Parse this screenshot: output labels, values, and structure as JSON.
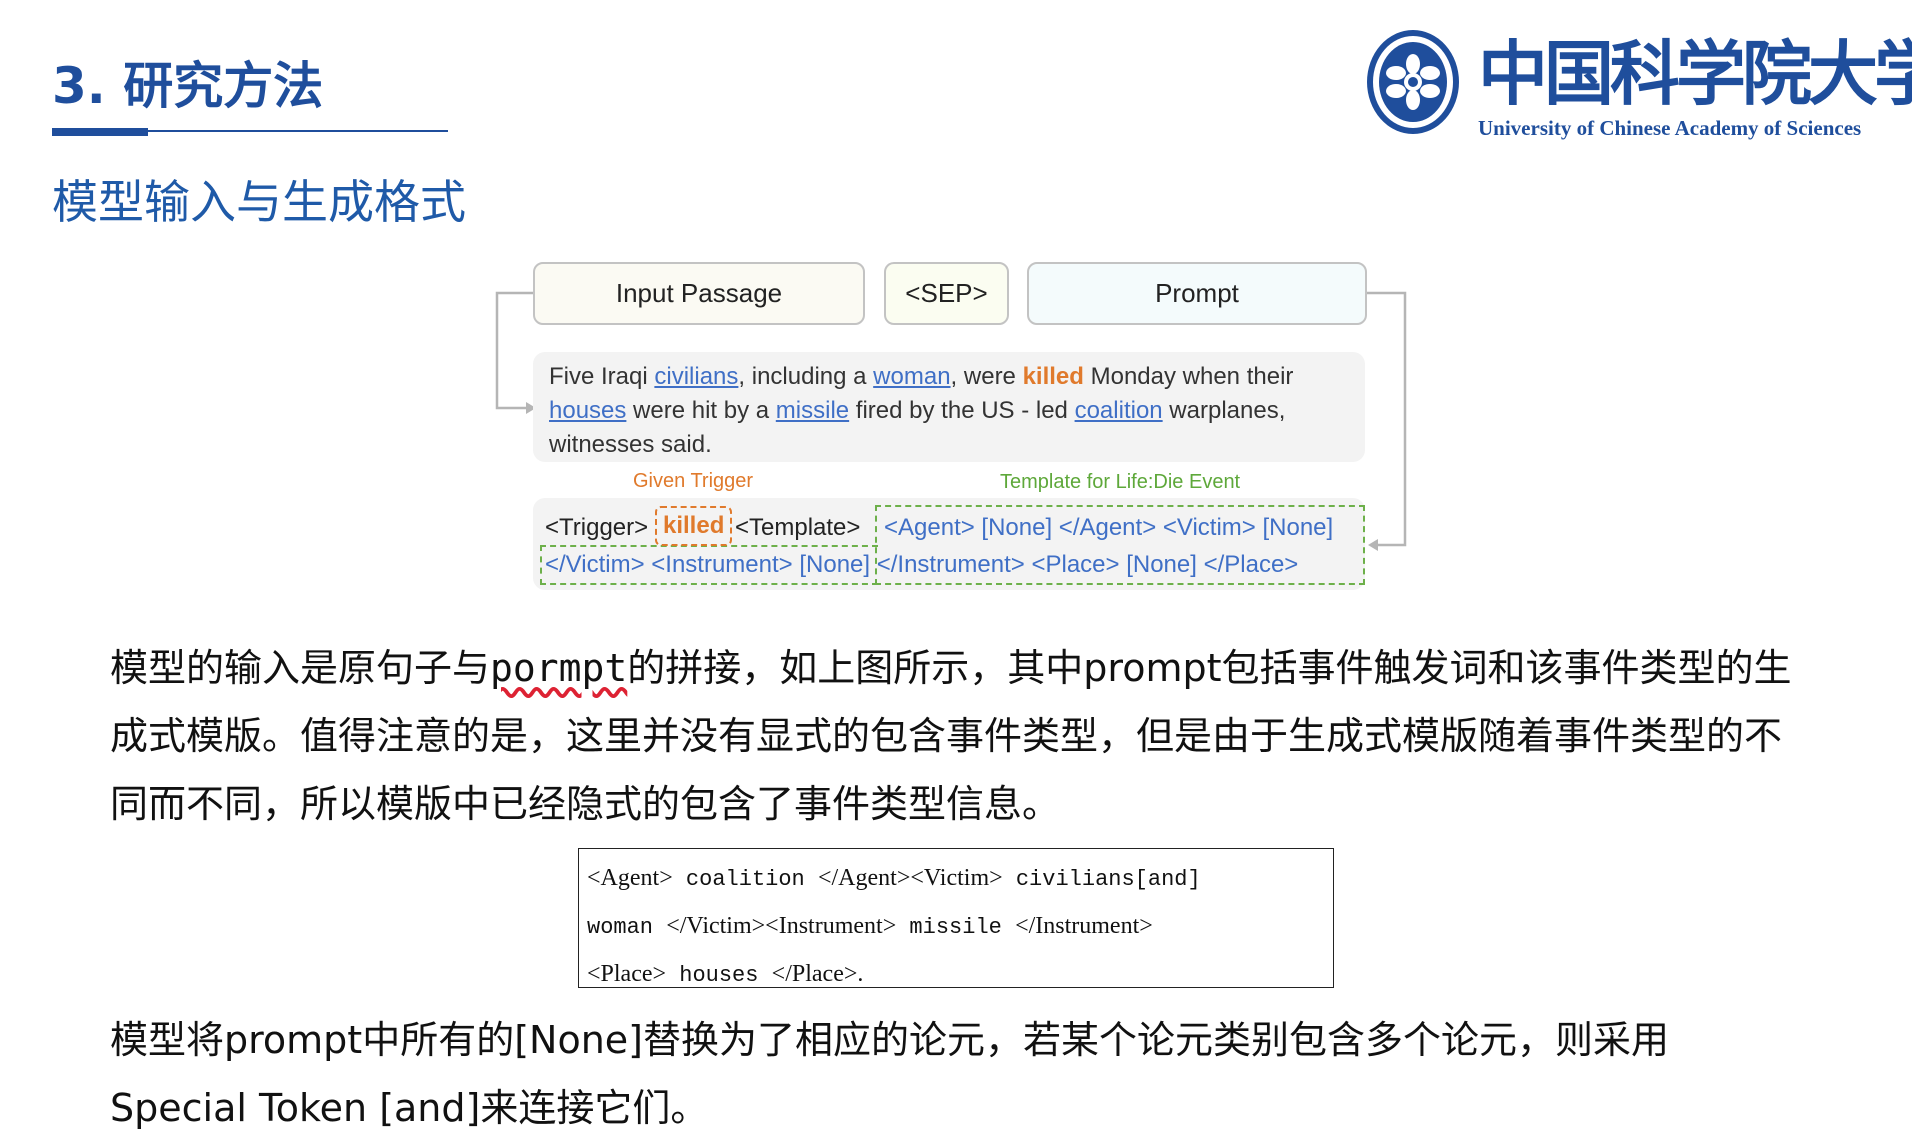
{
  "header": {
    "title": "3. 研究方法",
    "subtitle": "模型输入与生成格式"
  },
  "logo": {
    "chinese_name": "中国科学院大学",
    "english_name": "University of  Chinese Academy of Sciences"
  },
  "diagram": {
    "input_passage_label": "Input Passage",
    "sep_label": "<SEP>",
    "prompt_label": "Prompt",
    "passage": {
      "t1": "Five Iraqi ",
      "a1": "civilians",
      "t2": ", including a ",
      "a2": "woman",
      "t3": ", were ",
      "trigger": "killed",
      "t4": " Monday when their",
      "a3": "houses",
      "t5": " were hit by a ",
      "a4": "missile",
      "t6": " fired by the US - led ",
      "a5": "coalition",
      "t7": " warplanes,",
      "t8": "witnesses said."
    },
    "given_trigger_caption": "Given Trigger",
    "template_caption": "Template for Life:Die Event",
    "trigger_token": "<Trigger>",
    "trigger_word": "killed",
    "template_token": "<Template>",
    "template_line1": "<Agent> [None] </Agent> <Victim> [None]",
    "template_line2": "</Victim> <Instrument> [None] </Instrument> <Place> [None] </Place>"
  },
  "paragraph1": {
    "part1": "模型的输入是原句子与",
    "misspelled": "pormpt",
    "part2": "的拼接，如上图所示，其中prompt包括事件触发词和该事件类型的生成式模版。值得注意的是，这里并没有显式的包含事件类型，但是由于生成式模版随着事件类型的不同而不同，所以模版中已经隐式的包含了事件类型信息。"
  },
  "output_example": {
    "l1_tag1": "<Agent>",
    "l1_val1": " coalition ",
    "l1_tag2": "</Agent><Victim>",
    "l1_val2": " civilians[and]",
    "l2_val1": "woman ",
    "l2_tag1": "</Victim><Instrument>",
    "l2_val2": " missile ",
    "l2_tag2": "</Instrument>",
    "l3_tag1": "<Place>",
    "l3_val1": " houses ",
    "l3_tag2": "</Place>."
  },
  "paragraph2": {
    "text1": "模型将prompt中所有的[None]替换为了相应的论元，若某个论元类别包含多个论元，则采用",
    "text2": "Special Token [and]来连接它们。"
  }
}
